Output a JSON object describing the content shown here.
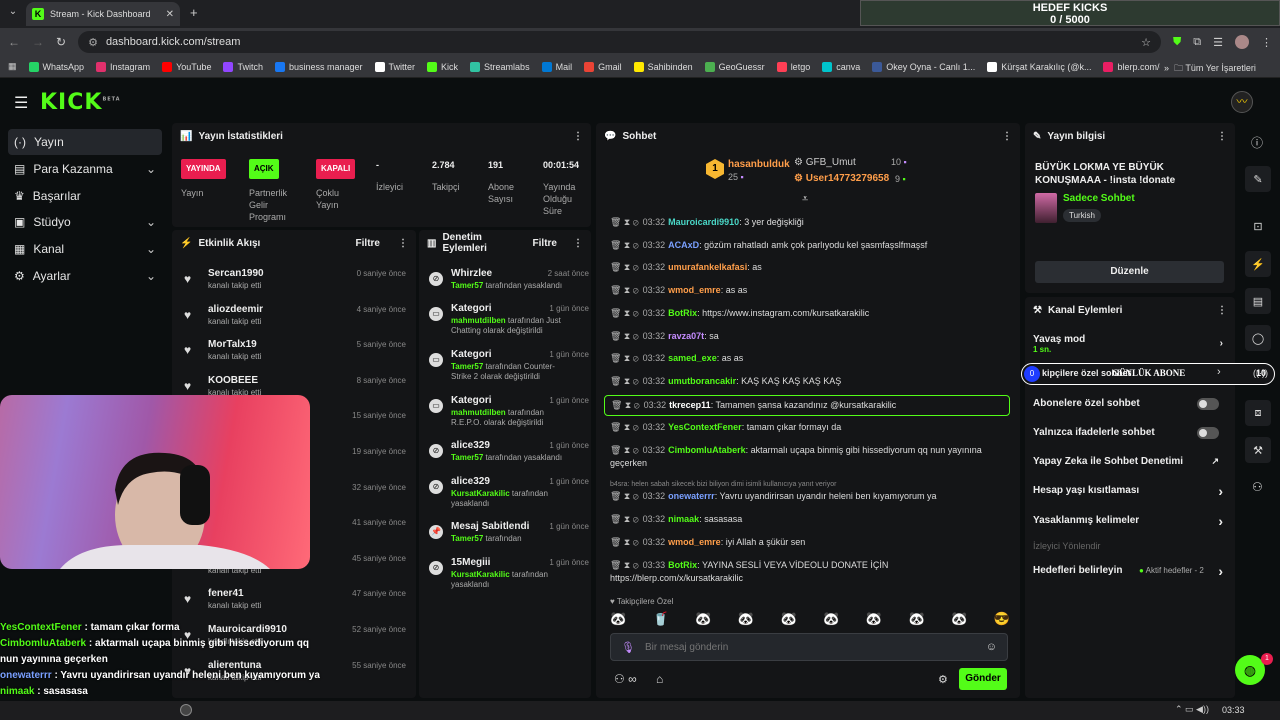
{
  "browser": {
    "tab_title": "Stream - Kick Dashboard",
    "url": "dashboard.kick.com/stream",
    "bookmarks": [
      "WhatsApp",
      "Instagram",
      "YouTube",
      "Twitch",
      "business manager",
      "Twitter",
      "Kick",
      "Streamlabs",
      "Mail",
      "Gmail",
      "Sahibinden",
      "GeoGuessr",
      "letgo",
      "canva",
      "Okey Oyna - Canlı 1...",
      "Kürşat Karakılıç (@k...",
      "blerp.com/dashboar..."
    ],
    "bookmark_colors": [
      "#25d366",
      "#e1306c",
      "#ff0000",
      "#9146ff",
      "#1877f2",
      "#ffffff",
      "#53fc18",
      "#31c3a2",
      "#0078d4",
      "#ea4335",
      "#ffe800",
      "#4caf50",
      "#ff3f55",
      "#00c4cc",
      "#3b5998",
      "#ffffff",
      "#e91e63"
    ],
    "all_bookmarks": "Tüm Yer İşaretleri"
  },
  "goal": {
    "title": "HEDEF KICKS",
    "progress": "0 / 5000"
  },
  "sidebar": {
    "items": [
      {
        "label": "Yayın",
        "icon": "stream-icon",
        "chev": ""
      },
      {
        "label": "Para Kazanma",
        "icon": "money-icon",
        "chev": "⌄"
      },
      {
        "label": "Başarılar",
        "icon": "trophy-icon",
        "chev": ""
      },
      {
        "label": "Stüdyo",
        "icon": "studio-icon",
        "chev": "⌄"
      },
      {
        "label": "Kanal",
        "icon": "channel-icon",
        "chev": "⌄"
      },
      {
        "label": "Ayarlar",
        "icon": "settings-icon",
        "chev": "⌄"
      }
    ]
  },
  "stats": {
    "title": "Yayın İstatistikleri",
    "items": [
      {
        "value": "YAYINDA",
        "label": "Yayın"
      },
      {
        "value": "AÇIK",
        "label": "Partnerlik Gelir Programı"
      },
      {
        "value": "KAPALI",
        "label": "Çoklu Yayın"
      },
      {
        "value": "-",
        "label": "İzleyici"
      },
      {
        "value": "2.784",
        "label": "Takipçi"
      },
      {
        "value": "191",
        "label": "Abone Sayısı"
      },
      {
        "value": "00:01:54",
        "label": "Yayında Olduğu Süre"
      }
    ]
  },
  "activity": {
    "title": "Etkinlik Akışı",
    "filter": "Filtre",
    "events": [
      {
        "name": "Sercan1990",
        "sub": "kanalı takip etti",
        "time": "0 saniye önce"
      },
      {
        "name": "aliozdeemir",
        "sub": "kanalı takip etti",
        "time": "4 saniye önce"
      },
      {
        "name": "MorTalx19",
        "sub": "kanalı takip etti",
        "time": "5 saniye önce"
      },
      {
        "name": "KOOBEEE",
        "sub": "kanalı takip etti",
        "time": "8 saniye önce"
      },
      {
        "name": "",
        "sub": "",
        "time": "15 saniye önce"
      },
      {
        "name": "",
        "sub": "",
        "time": "19 saniye önce"
      },
      {
        "name": "",
        "sub": "",
        "time": "32 saniye önce"
      },
      {
        "name": "",
        "sub": "",
        "time": "41 saniye önce"
      },
      {
        "name": "",
        "sub": "kanalı takip etti",
        "time": "45 saniye önce"
      },
      {
        "name": "fener41",
        "sub": "kanalı takip etti",
        "time": "47 saniye önce"
      },
      {
        "name": "Mauroicardi9910",
        "sub": "kanalı takip etti",
        "time": "52 saniye önce"
      },
      {
        "name": "alierentuna",
        "sub": "kanalı takip etti",
        "time": "55 saniye önce"
      }
    ]
  },
  "moderation": {
    "title": "Denetim Eylemleri",
    "filter": "Filtre",
    "items": [
      {
        "name": "Whirzlee",
        "pre": "",
        "by": "Tamer57",
        "rest": " tarafından yasaklandı",
        "time": "2 saat önce",
        "icon": "ban-icon"
      },
      {
        "name": "Kategori",
        "pre": "",
        "by": "mahmutdilben",
        "rest": " tarafından Just Chatting olarak değiştirildi",
        "time": "1 gün önce",
        "icon": "category-icon"
      },
      {
        "name": "Kategori",
        "pre": "",
        "by": "Tamer57",
        "rest": " tarafından Counter-Strike 2 olarak değiştirildi",
        "time": "1 gün önce",
        "icon": "category-icon"
      },
      {
        "name": "Kategori",
        "pre": "",
        "by": "mahmutdilben",
        "rest": " tarafından R.E.P.O. olarak değiştirildi",
        "time": "1 gün önce",
        "icon": "category-icon"
      },
      {
        "name": "alice329",
        "pre": "",
        "by": "Tamer57",
        "rest": " tarafından yasaklandı",
        "time": "1 gün önce",
        "icon": "ban-icon"
      },
      {
        "name": "alice329",
        "pre": "",
        "by": "KursatKarakilic",
        "rest": " tarafından yasaklandı",
        "time": "1 gün önce",
        "icon": "ban-icon"
      },
      {
        "name": "Mesaj Sabitlendi",
        "pre": "",
        "by": "Tamer57",
        "rest": " tarafından",
        "time": "1 gün önce",
        "icon": "pin-icon"
      },
      {
        "name": "15Megiii",
        "pre": "",
        "by": "KursatKarakilic",
        "rest": " tarafından yasaklandı",
        "time": "1 gün önce",
        "icon": "ban-icon"
      }
    ]
  },
  "chat": {
    "title": "Sohbet",
    "top_gifters": [
      {
        "rank": "1",
        "name": "hasanbulduk",
        "count": "25"
      },
      {
        "name": "GFB_Umut",
        "count": "10"
      },
      {
        "name": "User14773279658",
        "count": "9"
      }
    ],
    "messages": [
      {
        "time": "03:32",
        "user": "Mauroicardi9910",
        "color": "#4ad8c8",
        "text": ": 3 yer değişkliği"
      },
      {
        "time": "03:32",
        "user": "ACAxD",
        "color": "#7aa0ff",
        "text": ": gözüm rahatladı amk çok parlıyodu kel şasmfaşslfmaşsf"
      },
      {
        "time": "03:32",
        "user": "umurafankelkafasi",
        "color": "#ff9e4a",
        "text": ": as"
      },
      {
        "time": "03:32",
        "user": "wmod_emre",
        "color": "#ff9e4a",
        "text": ": as as"
      },
      {
        "time": "03:32",
        "user": "BotRix",
        "color": "#53fc18",
        "text": ": https://www.instagram.com/kursatkarakilic"
      },
      {
        "time": "03:32",
        "user": "ravza07t",
        "color": "#c58cff",
        "text": ": sa"
      },
      {
        "time": "03:32",
        "user": "samed_exe",
        "color": "#53fc18",
        "text": ": as as"
      },
      {
        "time": "03:32",
        "user": "umutborancakir",
        "color": "#53fc18",
        "text": ": KAŞ KAŞ KAŞ KAŞ KAŞ"
      },
      {
        "time": "03:32",
        "user": "tkrecep11",
        "color": "#ffffff",
        "text": ": Tamamen şansa kazandınız @kursatkarakilic"
      },
      {
        "time": "03:32",
        "user": "YesContextFener",
        "color": "#53fc18",
        "text": ": tamam çıkar formayı da"
      },
      {
        "time": "03:32",
        "user": "CimbomluAtaberk",
        "color": "#53fc18",
        "text": ": aktarmalı uçapa binmiş gibi hissediyorum qq nun yayınına geçerken"
      },
      {
        "time": "03:32",
        "user": "onewaterrr",
        "color": "#7aa0ff",
        "text": ": Yavru uyandirirsan uyandır heleni ben kıyamıyorum ya"
      },
      {
        "time": "03:32",
        "user": "nimaak",
        "color": "#53fc18",
        "text": ": sasasasa"
      },
      {
        "time": "03:32",
        "user": "wmod_emre",
        "color": "#ff9e4a",
        "text": ": iyi Allah a şükür sen"
      },
      {
        "time": "03:33",
        "user": "BotRix",
        "color": "#53fc18",
        "text": ": YAYINA SESLİ VEYA VİDEOLU DONATE İÇİN https://blerp.com/x/kursatkarakilic"
      }
    ],
    "reply_context": "b4sra: helen sabah sikecek bizi biliyon dimi isimli kullanıcıya yanıt veriyor",
    "mode_label": "Takipçilere Özel",
    "placeholder": "Bir mesaj gönderin",
    "send": "Gönder"
  },
  "stream_info": {
    "title": "Yayın bilgisi",
    "stream_title": "BÜYÜK LOKMA YE BÜYÜK KONUŞMAAA - !insta !donate",
    "category": "Sadece Sohbet",
    "tag": "Turkish",
    "edit": "Düzenle"
  },
  "channel_actions": {
    "title": "Kanal Eylemleri",
    "slow_mode": "Yavaş mod",
    "slow_mode_value": "1 sn.",
    "followers_chat": "kipçilere özel sohbet",
    "daily_sub_label": "GÜNLÜK ABONE",
    "daily_sub_current": "0",
    "daily_sub_target": "10",
    "subs_chat": "Abonelere özel sohbet",
    "emotes_chat": "Yalnızca ifadelerle sohbet",
    "ai_mod": "Yapay Zeka ile Sohbet Denetimi",
    "age_restrict": "Hesap yaşı kısıtlaması",
    "banned_words": "Yasaklanmış kelimeler",
    "redirect": "İzleyici Yönlendir",
    "goals": "Hedefleri belirleyin",
    "goals_active": "Aktif hedefler - 2"
  },
  "overlay_chat": [
    {
      "user": "YesContextFener",
      "text": " : tamam çıkar forma",
      "color": "#53fc18"
    },
    {
      "user": "CimbomluAtaberk",
      "text": " : aktarmalı uçapa binmiş gibi hissediyorum qq nun yayınına geçerken",
      "color": "#53fc18"
    },
    {
      "user": "onewaterrr",
      "text": " : Yavru uyandirirsan uyandır heleni ben kıyamıyorum ya",
      "color": "#7aa0ff"
    },
    {
      "user": "nimaak",
      "text": " : sasasasa",
      "color": "#53fc18"
    },
    {
      "user": "wmod_emre",
      "text": " : iyi Allah a şükür sen",
      "color": "#ff9e4a"
    }
  ],
  "taskbar": {
    "clock": "03:33"
  },
  "support_badge": "1"
}
